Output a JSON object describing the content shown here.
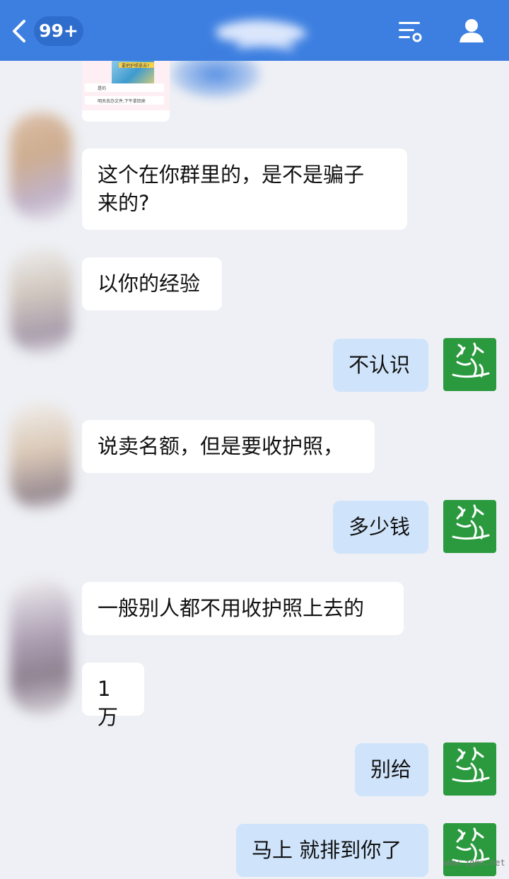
{
  "header": {
    "unread_badge": "99+",
    "back_icon": "chevron-left-icon",
    "menu_icon": "list-settings-icon",
    "profile_icon": "person-icon",
    "background": "#3d7fe0"
  },
  "shared_image": {
    "title": "要把护照拿去?",
    "line1": "是的",
    "line2": "明天去办文件,下午拿回来"
  },
  "messages": [
    {
      "side": "in",
      "text_line1": "这个在你群里的，是不是骗子",
      "text_line2": "来的?"
    },
    {
      "side": "in",
      "text": "以你的经验"
    },
    {
      "side": "out",
      "text": "不认识"
    },
    {
      "side": "in",
      "text": "说卖名额，但是要收护照，"
    },
    {
      "side": "out",
      "text": "多少钱"
    },
    {
      "side": "in",
      "text": "一般别人都不用收护照上去的"
    },
    {
      "side": "in",
      "text": "1万"
    },
    {
      "side": "out",
      "text": "别给"
    },
    {
      "side": "out",
      "text": "马上 就排到你了"
    }
  ],
  "colors": {
    "page_bg": "#eef0f5",
    "incoming_bubble": "#ffffff",
    "outgoing_bubble": "#cfe4fb",
    "my_avatar": "#2b9a3e"
  },
  "watermark": "www.zgmn.net"
}
